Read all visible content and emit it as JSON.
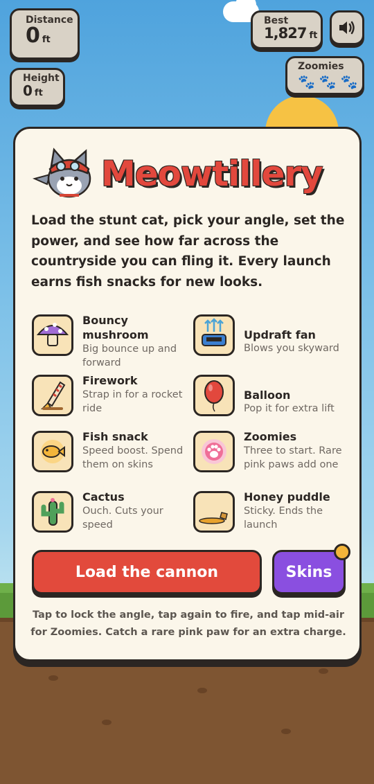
{
  "hud": {
    "distance": {
      "label": "Distance",
      "value": "0",
      "unit": "ft"
    },
    "height": {
      "label": "Height",
      "value": "0",
      "unit": "ft"
    },
    "best": {
      "label": "Best",
      "value": "1,827",
      "unit": "ft"
    },
    "zoomies": {
      "label": "Zoomies",
      "paws": [
        "paw-icon",
        "paw-icon",
        "paw-icon"
      ]
    },
    "sound_icon": "speaker-icon"
  },
  "modal": {
    "title": "Meowtillery",
    "intro": "Load the stunt cat, pick your angle, set the power, and see how far across the countryside you can fling it. Every launch earns fish snacks for new looks.",
    "items": [
      {
        "name": "Bouncy mushroom",
        "desc": "Big bounce up and forward",
        "icon": "mushroom-icon"
      },
      {
        "name": "Updraft fan",
        "desc": "Blows you skyward",
        "icon": "fan-icon"
      },
      {
        "name": "Firework",
        "desc": "Strap in for a rocket ride",
        "icon": "firework-icon"
      },
      {
        "name": "Balloon",
        "desc": "Pop it for extra lift",
        "icon": "balloon-icon"
      },
      {
        "name": "Fish snack",
        "desc": "Speed boost. Spend them on skins",
        "icon": "fish-icon"
      },
      {
        "name": "Zoomies",
        "desc": "Three to start. Rare pink paws add one",
        "icon": "pink-paw-icon"
      },
      {
        "name": "Cactus",
        "desc": "Ouch. Cuts your speed",
        "icon": "cactus-icon"
      },
      {
        "name": "Honey puddle",
        "desc": "Sticky. Ends the launch",
        "icon": "honey-icon"
      }
    ],
    "load_button": "Load the cannon",
    "skins_button": "Skins",
    "footer": "Tap to lock the angle, tap again to fire, and tap mid-air for Zoomies. Catch a rare pink paw for an extra charge."
  },
  "colors": {
    "accent_red": "#e24a3c",
    "accent_purple": "#8a4fe0",
    "card_bg": "#fbf6ea",
    "outline": "#2b2623"
  }
}
